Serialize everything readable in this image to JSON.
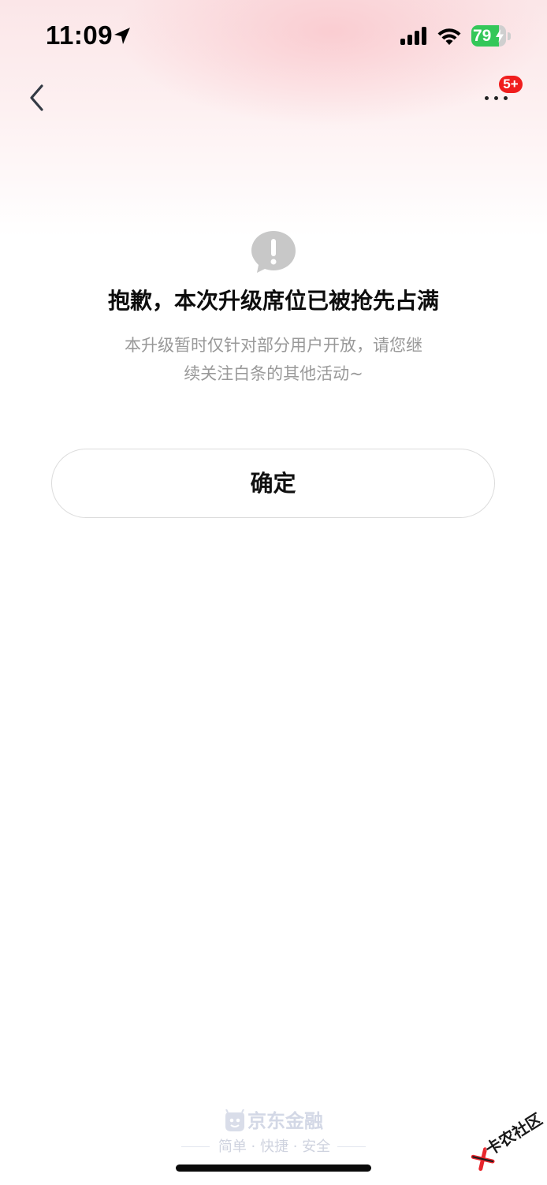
{
  "status_bar": {
    "time": "11:09",
    "battery_level": 79,
    "battery_label": "79",
    "battery_color": "#34c759"
  },
  "nav": {
    "back_icon": "chevron-left-icon",
    "more_icon": "more-dots-icon",
    "badge_text": "5+",
    "badge_color": "#f01d1d"
  },
  "main": {
    "alert_icon": "exclamation-circle-icon",
    "title": "抱歉，本次升级席位已被抢先占满",
    "description_lines": [
      "本升级暂时仅针对部分用户开放，请您继",
      "续关注白条的其他活动~"
    ],
    "confirm_label": "确定"
  },
  "footer": {
    "brand": "京东金融",
    "slogan": "简单 · 快捷 · 安全"
  },
  "watermark": {
    "text": "卡农社区"
  }
}
